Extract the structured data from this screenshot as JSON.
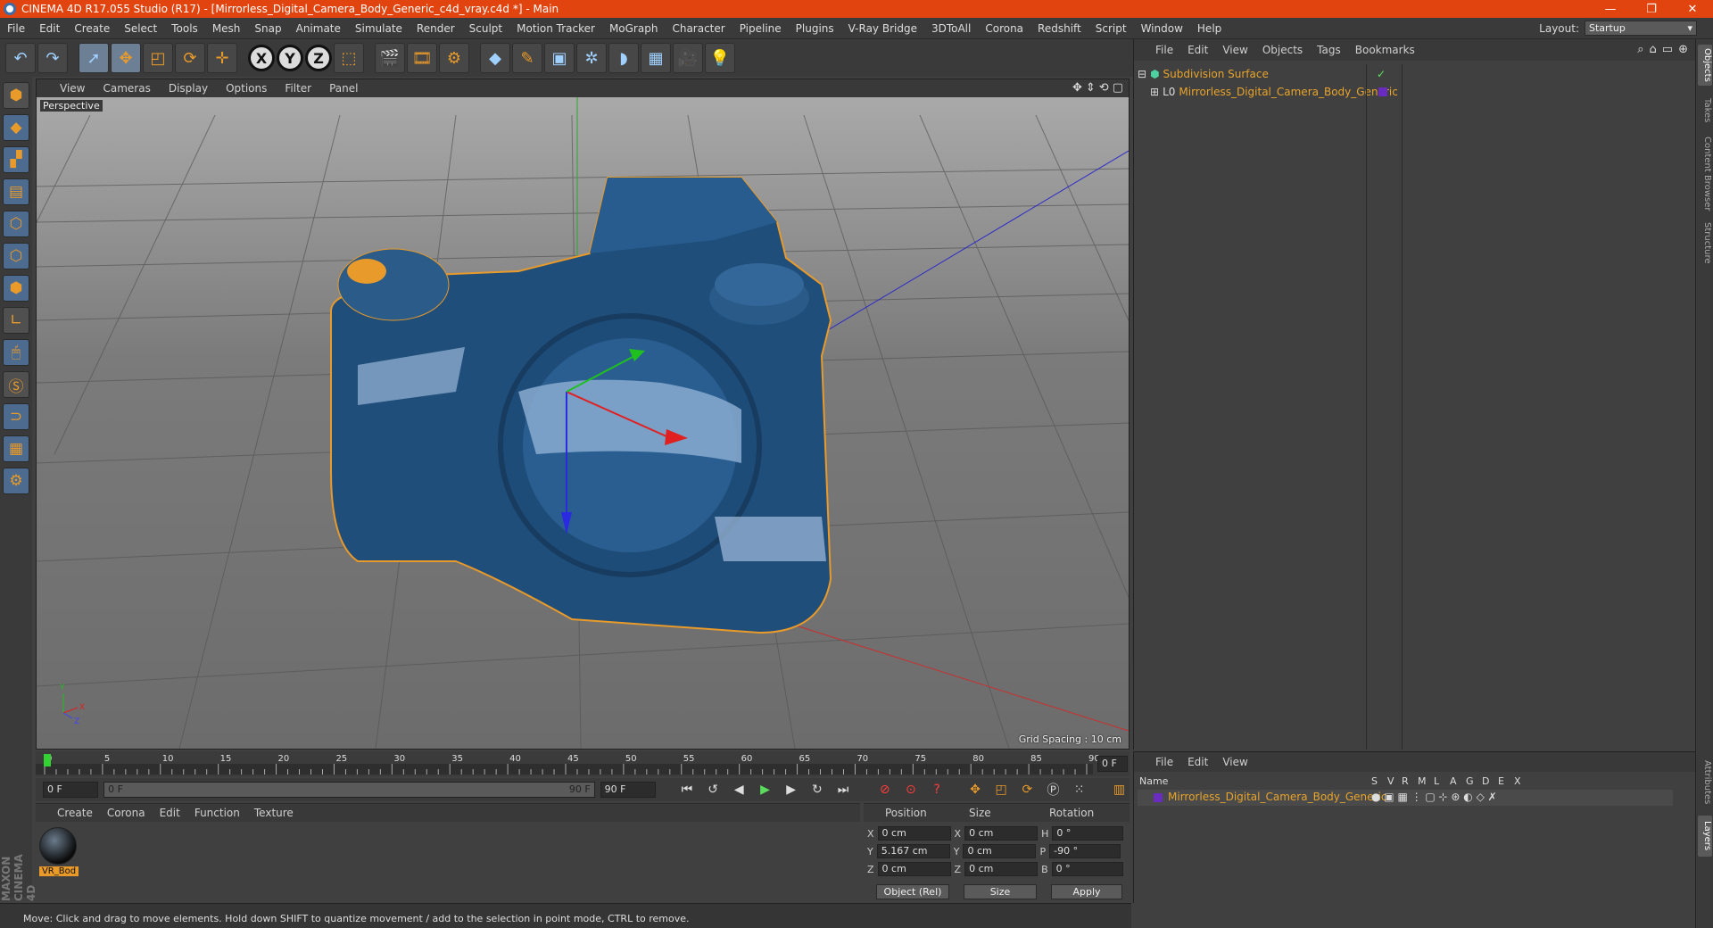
{
  "window": {
    "title": "CINEMA 4D R17.055 Studio (R17) - [Mirrorless_Digital_Camera_Body_Generic_c4d_vray.c4d *] - Main",
    "minimize": "—",
    "restore": "❐",
    "close": "✕"
  },
  "menu": [
    "File",
    "Edit",
    "Create",
    "Select",
    "Tools",
    "Mesh",
    "Snap",
    "Animate",
    "Simulate",
    "Render",
    "Sculpt",
    "Motion Tracker",
    "MoGraph",
    "Character",
    "Pipeline",
    "Plugins",
    "V-Ray Bridge",
    "3DToAll",
    "Corona",
    "Redshift",
    "Script",
    "Window",
    "Help"
  ],
  "layout": {
    "label": "Layout:",
    "value": "Startup"
  },
  "viewport": {
    "menu": [
      "View",
      "Cameras",
      "Display",
      "Options",
      "Filter",
      "Panel"
    ],
    "camera_label": "Perspective",
    "grid_spacing": "Grid Spacing : 10 cm",
    "axis_y": "Y",
    "axis_x": "X",
    "axis_z": "Z"
  },
  "timeline": {
    "ticks": [
      "0",
      "5",
      "10",
      "15",
      "20",
      "25",
      "30",
      "35",
      "40",
      "45",
      "50",
      "55",
      "60",
      "65",
      "70",
      "75",
      "80",
      "85",
      "90"
    ],
    "current_frame": "0 F",
    "start_field": "0 F",
    "range_start": "0 F",
    "range_end": "90 F",
    "end_field": "90 F"
  },
  "material_manager": {
    "menu": [
      "Create",
      "Corona",
      "Edit",
      "Function",
      "Texture"
    ],
    "materials": [
      {
        "name": "VR_Bod"
      }
    ]
  },
  "coordinates": {
    "headers": {
      "position": "Position",
      "size": "Size",
      "rotation": "Rotation"
    },
    "rows": [
      {
        "axis": "X",
        "pos": "0 cm",
        "size_axis": "X",
        "size": "0 cm",
        "rot_axis": "H",
        "rot": "0 °"
      },
      {
        "axis": "Y",
        "pos": "5.167 cm",
        "size_axis": "Y",
        "size": "0 cm",
        "rot_axis": "P",
        "rot": "-90 °"
      },
      {
        "axis": "Z",
        "pos": "0 cm",
        "size_axis": "Z",
        "size": "0 cm",
        "rot_axis": "B",
        "rot": "0 °"
      }
    ],
    "mode": "Object (Rel)",
    "size_mode": "Size",
    "apply": "Apply"
  },
  "status": "Move: Click and drag to move elements. Hold down SHIFT to quantize movement / add to the selection in point mode, CTRL to remove.",
  "maxon": "MAXON CINEMA 4D",
  "object_manager": {
    "menu": [
      "File",
      "Edit",
      "View",
      "Objects",
      "Tags",
      "Bookmarks"
    ],
    "objects": [
      {
        "name": "Subdivision Surface",
        "badge": "✓"
      },
      {
        "name": "Mirrorless_Digital_Camera_Body_Generic",
        "badge": ""
      }
    ]
  },
  "layer_manager": {
    "menu": [
      "File",
      "Edit",
      "View"
    ],
    "name_header": "Name",
    "flag_headers": [
      "S",
      "V",
      "R",
      "M",
      "L",
      "A",
      "G",
      "D",
      "E",
      "X"
    ],
    "layers": [
      {
        "name": "Mirrorless_Digital_Camera_Body_Generic"
      }
    ]
  },
  "side_tabs": [
    "Objects",
    "Takes",
    "Content Browser",
    "Structure",
    "Attributes",
    "Layers"
  ],
  "colors": {
    "title_bar": "#e1440f",
    "accent": "#e89a2a",
    "x_axis": "#e02020",
    "y_axis": "#20c020",
    "z_axis": "#3030e0"
  }
}
